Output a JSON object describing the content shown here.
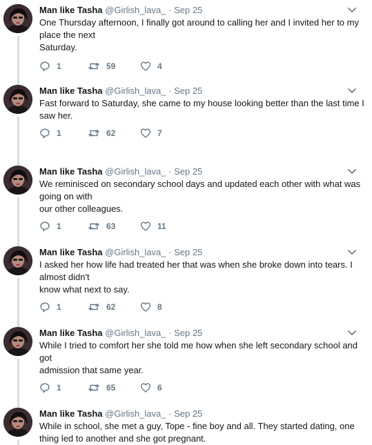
{
  "thread": {
    "tweets": [
      {
        "author": "Man like Tasha",
        "handle": "@Girlish_lava_",
        "dot": "·",
        "date": "Sep 25",
        "lines": [
          "One Thursday afternoon, I finally got around to calling her and I invited her to my",
          "place the next",
          "Saturday."
        ],
        "replies": "1",
        "retweets": "59",
        "likes": "4"
      },
      {
        "author": "Man like Tasha",
        "handle": "@Girlish_lava_",
        "dot": "·",
        "date": "Sep 25",
        "lines": [
          "Fast forward to Saturday, she came to my house looking better than the last time I",
          "saw her."
        ],
        "replies": "1",
        "retweets": "62",
        "likes": "7"
      },
      {
        "author": "Man like Tasha",
        "handle": "@Girlish_lava_",
        "dot": "·",
        "date": "Sep 25",
        "lines": [
          "We reminisced on secondary school days and updated each other with what was",
          "going on with",
          "our other colleagues."
        ],
        "replies": "1",
        "retweets": "63",
        "likes": "11"
      },
      {
        "author": "Man like Tasha",
        "handle": "@Girlish_lava_",
        "dot": "·",
        "date": "Sep 25",
        "lines": [
          "I asked her how life had treated her that was when she broke down into tears. I",
          "almost didn't",
          "know what next to say."
        ],
        "replies": "1",
        "retweets": "62",
        "likes": "8"
      },
      {
        "author": "Man like Tasha",
        "handle": "@Girlish_lava_",
        "dot": "·",
        "date": "Sep 25",
        "lines": [
          "While I tried to comfort her she told me how when she left secondary school and",
          "got",
          "admission that same year."
        ],
        "replies": "1",
        "retweets": "65",
        "likes": "6"
      },
      {
        "author": "Man like Tasha",
        "handle": "@Girlish_lava_",
        "dot": "·",
        "date": "Sep 25",
        "lines": [
          "While in school, she met a guy, Tope - fine boy and all. They started dating, one",
          "thing led to another and she got pregnant."
        ]
      }
    ]
  },
  "icons": {
    "reply": "reply-icon",
    "retweet": "retweet-icon",
    "like": "heart-icon",
    "more": "chevron-down-icon"
  },
  "colors": {
    "muted": "#657786",
    "text": "#14171a",
    "thread_line": "#d7dde1"
  }
}
